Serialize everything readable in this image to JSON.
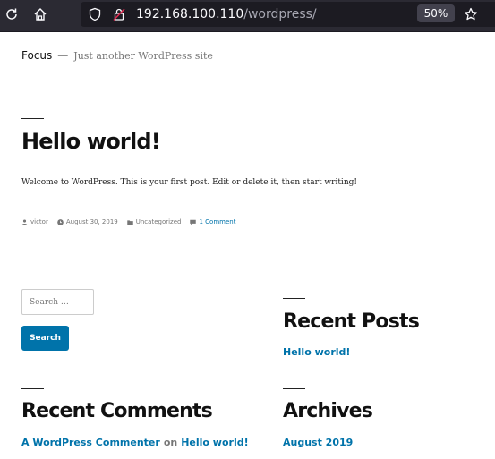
{
  "browser": {
    "url_host": "192.168.100.110",
    "url_path": "/wordpress/",
    "zoom": "50%",
    "icons": [
      "reload-icon",
      "home-icon",
      "shield-icon",
      "insecure-lock-icon",
      "star-icon"
    ]
  },
  "site": {
    "title": "Focus",
    "separator": "—",
    "description": "Just another WordPress site"
  },
  "post": {
    "title": "Hello world!",
    "body": "Welcome to WordPress. This is your first post. Edit or delete it, then start writing!",
    "meta": {
      "author": "victor",
      "date": "August 30, 2019",
      "category": "Uncategorized",
      "comments": "1 Comment"
    }
  },
  "search": {
    "placeholder": "Search …",
    "button_label": "Search"
  },
  "recent_posts": {
    "title": "Recent Posts",
    "items": [
      "Hello world!"
    ]
  },
  "recent_comments": {
    "title": "Recent Comments",
    "author": "A WordPress Commenter",
    "on_text": "on",
    "post": "Hello world!"
  },
  "archives": {
    "title": "Archives",
    "items": [
      "August 2019"
    ]
  },
  "colors": {
    "toolbar_bg": "#2b2a33",
    "urlbar_bg": "#1c1b22",
    "link": "#0073aa",
    "button_bg": "#0073aa",
    "text": "#111111",
    "muted": "#767676"
  }
}
